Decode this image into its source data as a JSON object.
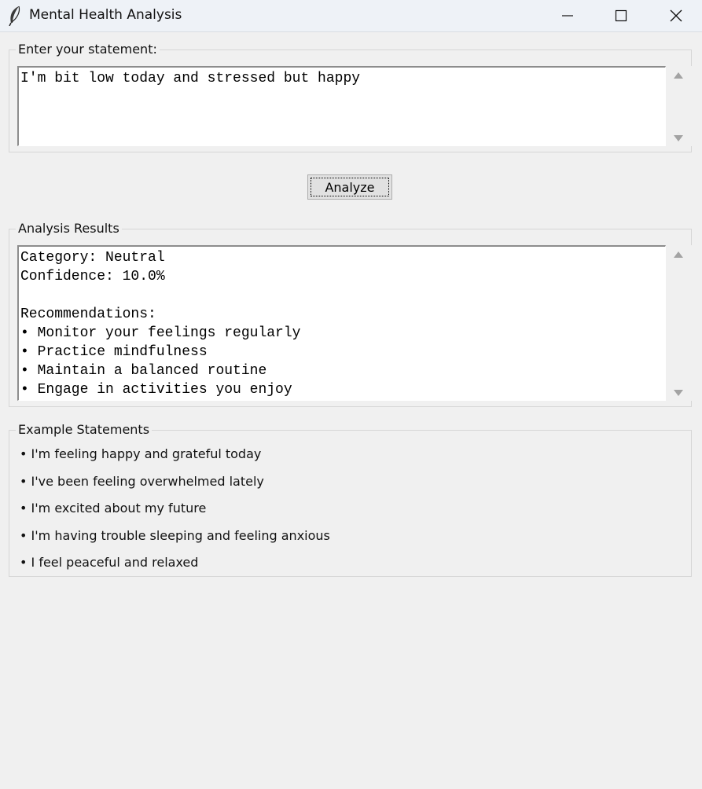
{
  "window": {
    "title": "Mental Health Analysis",
    "icon": "feather-icon",
    "controls": [
      "minimize-icon",
      "maximize-icon",
      "close-icon"
    ]
  },
  "input_section": {
    "label": "Enter your statement:",
    "value": "I'm bit low today and stressed but happy"
  },
  "analyze_button": {
    "label": "Analyze"
  },
  "results_section": {
    "label": "Analysis Results",
    "text": "Category: Neutral\nConfidence: 10.0%\n\nRecommendations:\n• Monitor your feelings regularly\n• Practice mindfulness\n• Maintain a balanced routine\n• Engage in activities you enjoy"
  },
  "examples_section": {
    "label": "Example Statements",
    "items": [
      "• I'm feeling happy and grateful today",
      "• I've been feeling overwhelmed lately",
      "• I'm excited about my future",
      "• I'm having trouble sleeping and feeling anxious",
      "• I feel peaceful and relaxed"
    ]
  },
  "colors": {
    "background": "#f0f0f0",
    "titlebar": "#eef2f7",
    "text_area": "#ffffff",
    "button": "#e1e1e1"
  }
}
